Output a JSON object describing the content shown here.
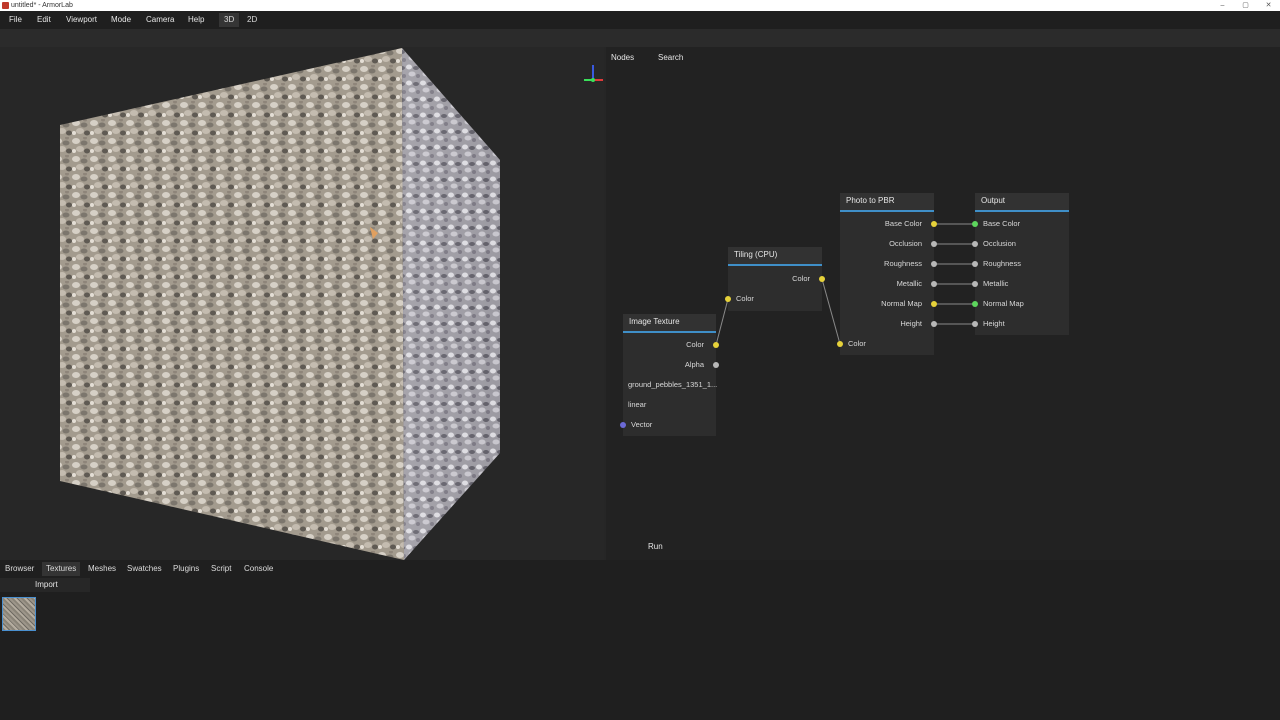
{
  "window": {
    "title": "untitled* - ArmorLab",
    "buttons": [
      "–",
      "▢",
      "✕"
    ]
  },
  "menu": {
    "items": [
      "File",
      "Edit",
      "Viewport",
      "Mode",
      "Camera",
      "Help"
    ],
    "modes": [
      "3D",
      "2D"
    ],
    "active_mode": "3D"
  },
  "node_editor": {
    "tabs": [
      "Nodes",
      "Search"
    ],
    "run_label": "Run",
    "nodes": {
      "image_texture": {
        "title": "Image Texture",
        "out_color": "Color",
        "out_alpha": "Alpha",
        "file": "ground_pebbles_1351_1...",
        "color_space": "linear",
        "in_vector": "Vector"
      },
      "tiling": {
        "title": "Tiling (CPU)",
        "out_color": "Color",
        "in_color": "Color"
      },
      "photo_to_pbr": {
        "title": "Photo to PBR",
        "outputs": [
          "Base Color",
          "Occlusion",
          "Roughness",
          "Metallic",
          "Normal Map",
          "Height"
        ],
        "in_color": "Color"
      },
      "output": {
        "title": "Output",
        "inputs": [
          "Base Color",
          "Occlusion",
          "Roughness",
          "Metallic",
          "Normal Map",
          "Height"
        ]
      }
    }
  },
  "bottom_panel": {
    "tabs": [
      "Browser",
      "Textures",
      "Meshes",
      "Swatches",
      "Plugins",
      "Script",
      "Console"
    ],
    "active_tab": "Textures",
    "import_label": "Import"
  },
  "colors": {
    "accent": "#3f8fc8",
    "socket_color": "#e6d23a",
    "socket_float": "#b8b8b8",
    "socket_vector": "#6c6ad6",
    "socket_connected": "#5dd65d"
  }
}
